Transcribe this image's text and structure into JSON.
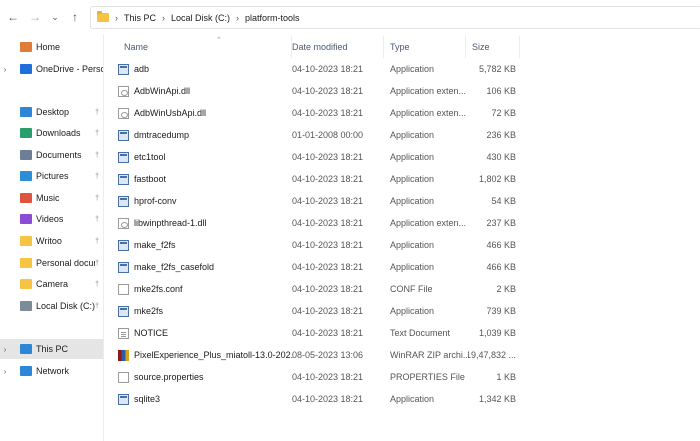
{
  "address": {
    "breadcrumbs": [
      "This PC",
      "Local Disk (C:)",
      "platform-tools"
    ]
  },
  "sidebar": {
    "items": [
      {
        "label": "Home",
        "icon": "home-icon",
        "color": "#e07b39",
        "chevron": false,
        "pin": false,
        "selected": false
      },
      {
        "label": "OneDrive - Person",
        "icon": "cloud-icon",
        "color": "#1e6fd9",
        "chevron": true,
        "pin": false,
        "selected": false
      },
      {
        "label": "Desktop",
        "icon": "desktop-icon",
        "color": "#2d86d6",
        "chevron": false,
        "pin": true,
        "selected": false
      },
      {
        "label": "Downloads",
        "icon": "download-icon",
        "color": "#2a9d6d",
        "chevron": false,
        "pin": true,
        "selected": false
      },
      {
        "label": "Documents",
        "icon": "documents-icon",
        "color": "#6d7f96",
        "chevron": false,
        "pin": true,
        "selected": false
      },
      {
        "label": "Pictures",
        "icon": "pictures-icon",
        "color": "#2b8fd6",
        "chevron": false,
        "pin": true,
        "selected": false
      },
      {
        "label": "Music",
        "icon": "music-icon",
        "color": "#e0533d",
        "chevron": false,
        "pin": true,
        "selected": false
      },
      {
        "label": "Videos",
        "icon": "videos-icon",
        "color": "#8c4bd6",
        "chevron": false,
        "pin": true,
        "selected": false
      },
      {
        "label": "Writoo",
        "icon": "folder-icon",
        "color": "#f6c343",
        "chevron": false,
        "pin": true,
        "selected": false
      },
      {
        "label": "Personal docum",
        "icon": "folder-icon",
        "color": "#f6c343",
        "chevron": false,
        "pin": true,
        "selected": false
      },
      {
        "label": "Camera",
        "icon": "folder-icon",
        "color": "#f6c343",
        "chevron": false,
        "pin": true,
        "selected": false
      },
      {
        "label": "Local Disk (C:)",
        "icon": "drive-icon",
        "color": "#7d8a99",
        "chevron": false,
        "pin": true,
        "selected": false
      },
      {
        "label": "This PC",
        "icon": "computer-icon",
        "color": "#2d86d6",
        "chevron": true,
        "pin": false,
        "selected": true
      },
      {
        "label": "Network",
        "icon": "network-icon",
        "color": "#2d86d6",
        "chevron": true,
        "pin": false,
        "selected": false
      }
    ]
  },
  "columns": {
    "name": "Name",
    "date": "Date modified",
    "type": "Type",
    "size": "Size"
  },
  "files": [
    {
      "name": "adb",
      "date": "04-10-2023 18:21",
      "type": "Application",
      "size": "5,782 KB",
      "icon": "app"
    },
    {
      "name": "AdbWinApi.dll",
      "date": "04-10-2023 18:21",
      "type": "Application exten...",
      "size": "106 KB",
      "icon": "dll"
    },
    {
      "name": "AdbWinUsbApi.dll",
      "date": "04-10-2023 18:21",
      "type": "Application exten...",
      "size": "72 KB",
      "icon": "dll"
    },
    {
      "name": "dmtracedump",
      "date": "01-01-2008 00:00",
      "type": "Application",
      "size": "236 KB",
      "icon": "app"
    },
    {
      "name": "etc1tool",
      "date": "04-10-2023 18:21",
      "type": "Application",
      "size": "430 KB",
      "icon": "app"
    },
    {
      "name": "fastboot",
      "date": "04-10-2023 18:21",
      "type": "Application",
      "size": "1,802 KB",
      "icon": "app"
    },
    {
      "name": "hprof-conv",
      "date": "04-10-2023 18:21",
      "type": "Application",
      "size": "54 KB",
      "icon": "app"
    },
    {
      "name": "libwinpthread-1.dll",
      "date": "04-10-2023 18:21",
      "type": "Application exten...",
      "size": "237 KB",
      "icon": "dll"
    },
    {
      "name": "make_f2fs",
      "date": "04-10-2023 18:21",
      "type": "Application",
      "size": "466 KB",
      "icon": "app"
    },
    {
      "name": "make_f2fs_casefold",
      "date": "04-10-2023 18:21",
      "type": "Application",
      "size": "466 KB",
      "icon": "app"
    },
    {
      "name": "mke2fs.conf",
      "date": "04-10-2023 18:21",
      "type": "CONF File",
      "size": "2 KB",
      "icon": "doc"
    },
    {
      "name": "mke2fs",
      "date": "04-10-2023 18:21",
      "type": "Application",
      "size": "739 KB",
      "icon": "app"
    },
    {
      "name": "NOTICE",
      "date": "04-10-2023 18:21",
      "type": "Text Document",
      "size": "1,039 KB",
      "icon": "txt"
    },
    {
      "name": "PixelExperience_Plus_miatoll-13.0-202...",
      "date": "08-05-2023 13:06",
      "type": "WinRAR ZIP archi...",
      "size": "19,47,832 ...",
      "icon": "zip"
    },
    {
      "name": "source.properties",
      "date": "04-10-2023 18:21",
      "type": "PROPERTIES File",
      "size": "1 KB",
      "icon": "doc"
    },
    {
      "name": "sqlite3",
      "date": "04-10-2023 18:21",
      "type": "Application",
      "size": "1,342 KB",
      "icon": "app"
    }
  ]
}
